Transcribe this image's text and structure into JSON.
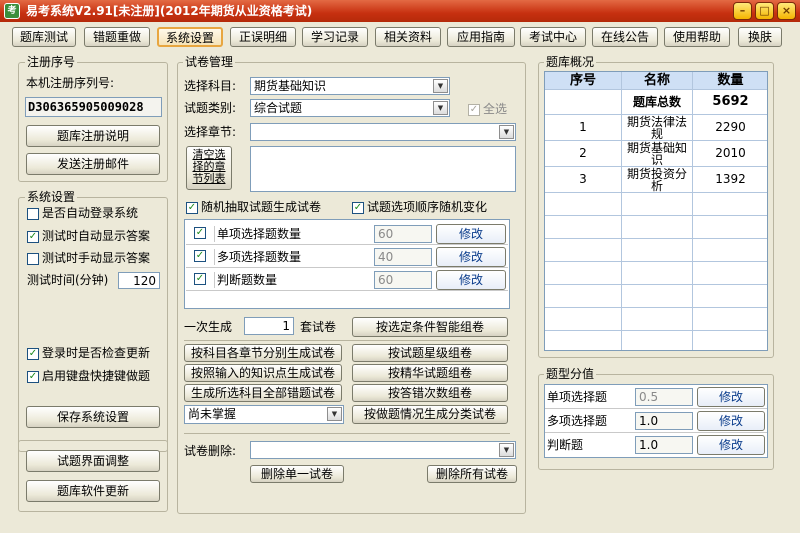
{
  "window": {
    "title": "易考系统V2.91[未注册](2012年期货从业资格考试)",
    "icon": "考"
  },
  "nav": [
    "题库测试",
    "错题重做",
    "系统设置",
    "正误明细",
    "学习记录",
    "相关资料",
    "应用指南",
    "考试中心",
    "在线公告",
    "使用帮助",
    "换肤"
  ],
  "reg": {
    "title": "注册序号",
    "serial_label": "本机注册序列号:",
    "serial_value": "D306365905009028",
    "btn_info": "题库注册说明",
    "btn_mail": "发送注册邮件"
  },
  "sys": {
    "title": "系统设置",
    "auto_login": "是否自动登录系统",
    "auto_show": "测试时自动显示答案",
    "manual_show": "测试时手动显示答案",
    "time_label": "测试时间(分钟)",
    "time_value": "120",
    "check_update": "登录时是否检查更新",
    "hotkey": "启用键盘快捷键做题",
    "save_btn": "保存系统设置"
  },
  "left_bottom": {
    "btn_ui": "试题界面调整",
    "btn_update": "题库软件更新"
  },
  "paper": {
    "title": "试卷管理",
    "subject_label": "选择科目:",
    "subject_value": "期货基础知识",
    "category_label": "试题类别:",
    "category_value": "综合试题",
    "select_all": "全选",
    "chapter_label": "选择章节:",
    "clear_btn": "清空选择的章节列表",
    "random_extract": "随机抽取试题生成试卷",
    "random_order": "试题选项顺序随机变化",
    "rows": [
      {
        "label": "单项选择题数量",
        "value": "60",
        "btn": "修改"
      },
      {
        "label": "多项选择题数量",
        "value": "40",
        "btn": "修改"
      },
      {
        "label": "判断题数量",
        "value": "60",
        "btn": "修改"
      }
    ],
    "gen_prefix": "一次生成",
    "gen_count": "1",
    "gen_suffix": "套试卷",
    "btn_smart": "按选定条件智能组卷",
    "btn_chapter": "按科目各章节分别生成试卷",
    "btn_star": "按试题星级组卷",
    "btn_knowledge": "按照输入的知识点生成试卷",
    "btn_fine": "按精华试题组卷",
    "btn_wrong_all": "生成所选科目全部错题试卷",
    "btn_wrong_count": "按答错次数组卷",
    "mastery_value": "尚未掌握",
    "btn_status": "按做题情况生成分类试卷",
    "delete_label": "试卷删除:",
    "btn_del_one": "删除单一试卷",
    "btn_del_all": "删除所有试卷"
  },
  "overview": {
    "title": "题库概况",
    "headers": [
      "序号",
      "名称",
      "数量"
    ],
    "total_label": "题库总数",
    "total_value": "5692",
    "rows": [
      {
        "no": "1",
        "name": "期货法律法规",
        "count": "2290"
      },
      {
        "no": "2",
        "name": "期货基础知识",
        "count": "2010"
      },
      {
        "no": "3",
        "name": "期货投资分析",
        "count": "1392"
      }
    ]
  },
  "score": {
    "title": "题型分值",
    "rows": [
      {
        "label": "单项选择题",
        "value": "0.5",
        "btn": "修改"
      },
      {
        "label": "多项选择题",
        "value": "1.0",
        "btn": "修改"
      },
      {
        "label": "判断题",
        "value": "1.0",
        "btn": "修改"
      }
    ]
  },
  "colors": {
    "titlebar": "#c73010",
    "grid_header": "#cfe0f5",
    "check": "#1b8a1b"
  }
}
